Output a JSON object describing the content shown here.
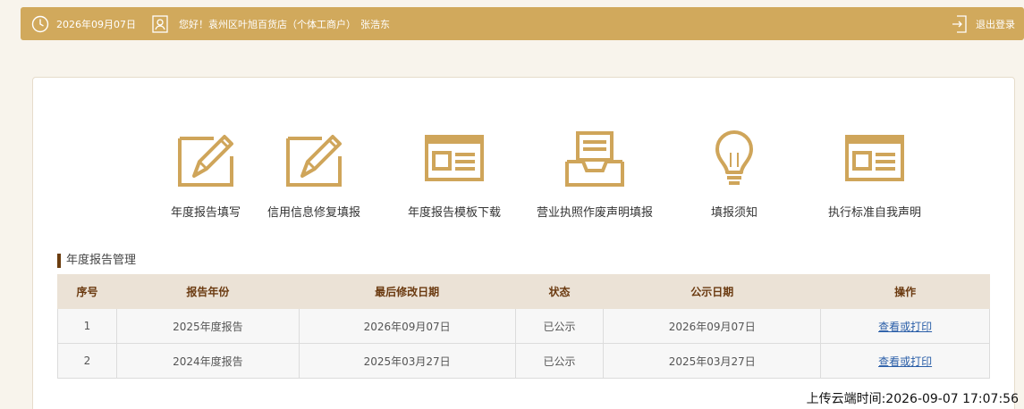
{
  "header": {
    "date": "2026年09月07日",
    "greeting": "您好！袁州区叶旭百货店（个体工商户）",
    "user": "张浩东",
    "logout": "退出登录"
  },
  "menu": [
    {
      "label": "年度报告填写",
      "icon": "edit-icon"
    },
    {
      "label": "信用信息修复填报",
      "icon": "edit-icon"
    },
    {
      "label": "年度报告模板下载",
      "icon": "document-panel-icon"
    },
    {
      "label": "营业执照作废声明填报",
      "icon": "inbox-tray-icon"
    },
    {
      "label": "填报须知",
      "icon": "lightbulb-icon"
    },
    {
      "label": "执行标准自我声明",
      "icon": "document-panel-icon"
    }
  ],
  "section": {
    "title": "年度报告管理"
  },
  "table": {
    "headers": [
      "序号",
      "报告年份",
      "最后修改日期",
      "状态",
      "公示日期",
      "操作"
    ],
    "rows": [
      [
        "1",
        "2025年度报告",
        "2026年09月07日",
        "已公示",
        "2026年09月07日",
        "查看或打印"
      ],
      [
        "2",
        "2024年度报告",
        "2025年03月27日",
        "已公示",
        "2025年03月27日",
        "查看或打印"
      ]
    ]
  },
  "footer": {
    "upload_time": "上传云端时间:2026-09-07 17:07:56"
  },
  "colors": {
    "accent": "#d1a95c",
    "icon": "#cfa55a",
    "header_bg": "#ebe2d6",
    "link": "#2a5ea8"
  }
}
